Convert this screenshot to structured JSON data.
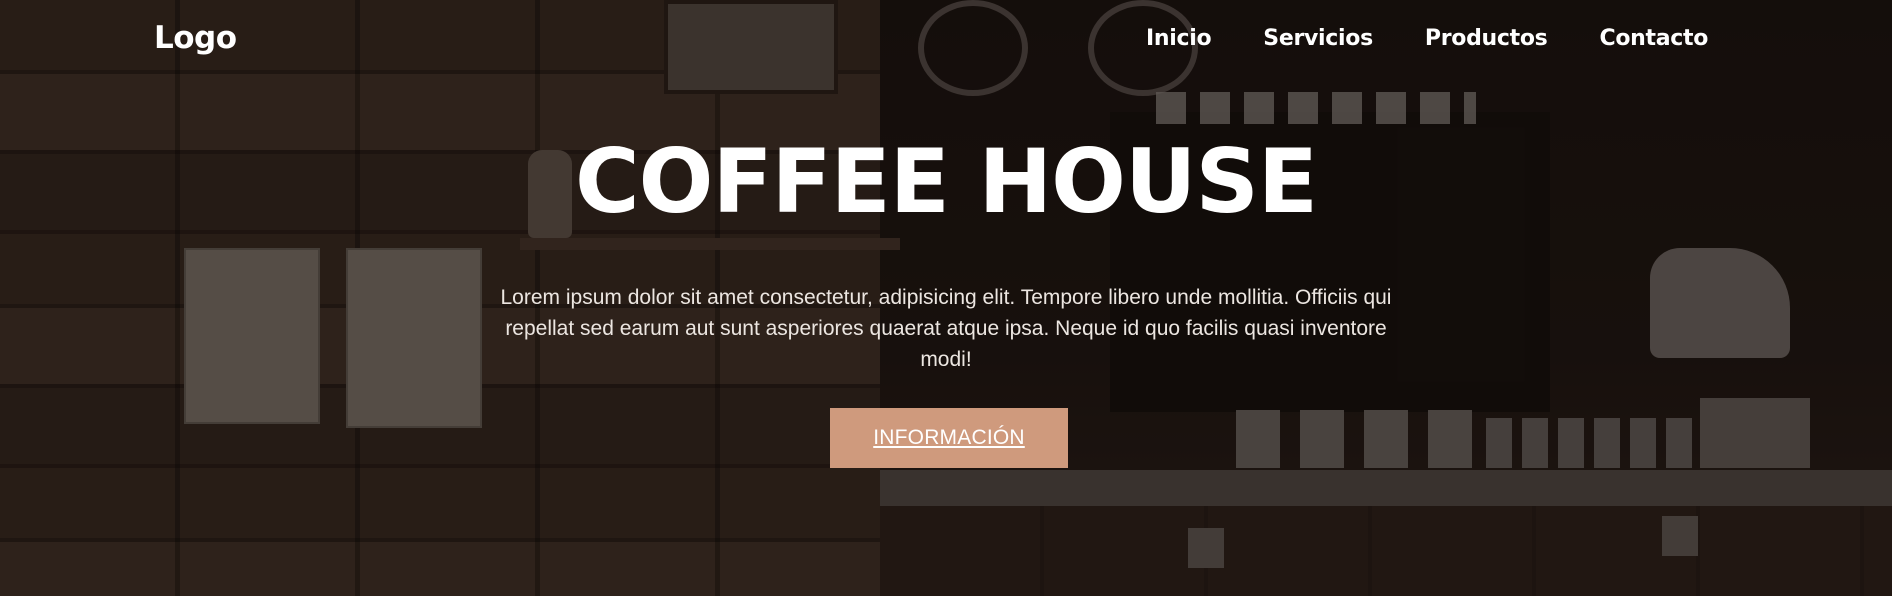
{
  "nav": {
    "logo": "Logo",
    "items": [
      {
        "label": "Inicio"
      },
      {
        "label": "Servicios"
      },
      {
        "label": "Productos"
      },
      {
        "label": "Contacto"
      }
    ]
  },
  "hero": {
    "title": "COFFEE HOUSE",
    "description": "Lorem ipsum dolor sit amet consectetur, adipisicing elit. Tempore libero unde mollitia. Officiis qui repellat sed earum aut sunt asperiores quaerat atque ipsa. Neque id quo facilis quasi inventore modi!",
    "button_label": "INFORMACIÓN"
  },
  "colors": {
    "accent": "#cf9a7d",
    "text": "#ffffff",
    "overlay": "#120c09"
  }
}
